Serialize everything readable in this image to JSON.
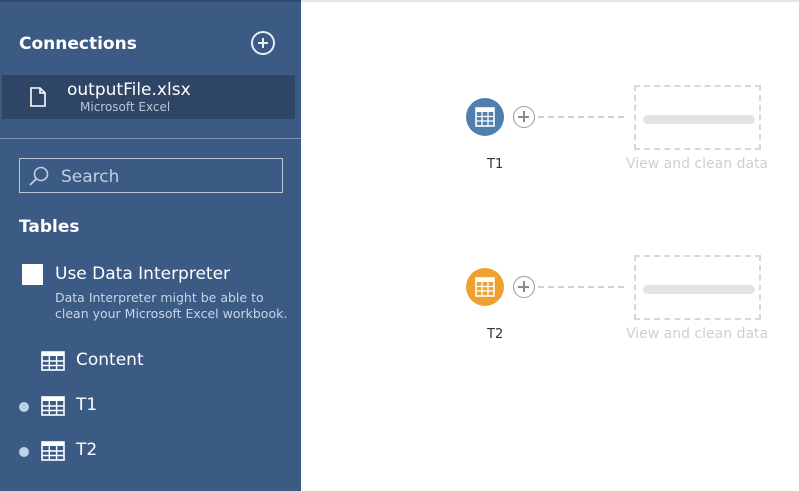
{
  "sidebar": {
    "connections_title": "Connections",
    "connection": {
      "name": "outputFile.xlsx",
      "type": "Microsoft Excel"
    },
    "search": {
      "placeholder": "Search"
    },
    "tables_title": "Tables",
    "data_interpreter": {
      "checked": false,
      "label": "Use Data Interpreter",
      "description": "Data Interpreter might be able to clean your Microsoft Excel workbook."
    },
    "tables": [
      {
        "label": "Content",
        "in_flow": false
      },
      {
        "label": "T1",
        "in_flow": true
      },
      {
        "label": "T2",
        "in_flow": true
      }
    ]
  },
  "canvas": {
    "steps": [
      {
        "label": "T1",
        "color": "#4e7fad",
        "next_step_label": "View and clean data"
      },
      {
        "label": "T2",
        "color": "#f0a030",
        "next_step_label": "View and clean data"
      }
    ]
  },
  "icons": {
    "add_connection": "plus-circle-icon",
    "file": "file-icon",
    "search": "search-icon",
    "table": "table-grid-icon",
    "add_step": "plus-circle-icon"
  }
}
